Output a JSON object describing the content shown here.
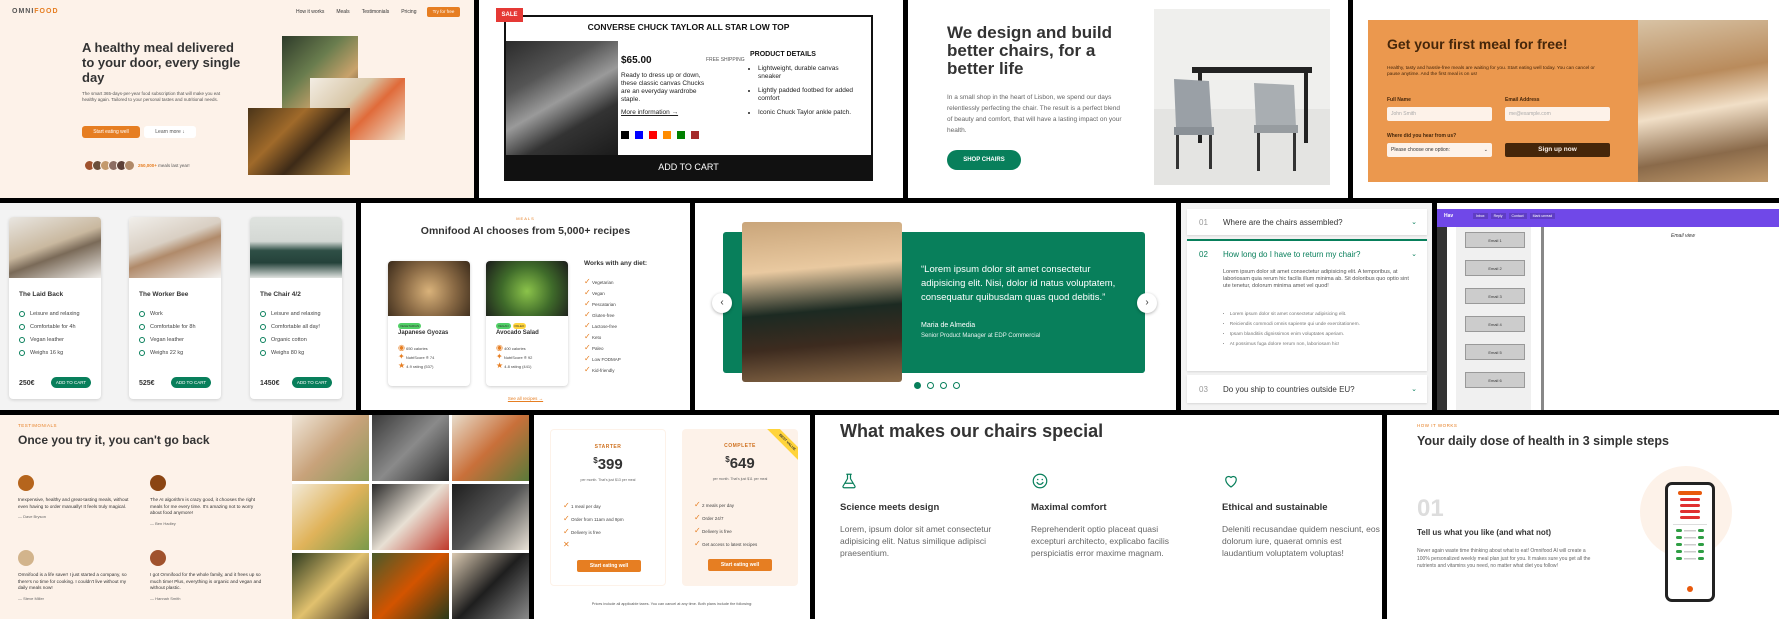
{
  "hero": {
    "logo_main": "OMNI",
    "logo_accent": "FOOD",
    "nav": [
      "How it works",
      "Meals",
      "Testimonials",
      "Pricing"
    ],
    "nav_cta": "Try for free",
    "title": "A healthy meal delivered to your door, every single day",
    "text": "The smart 365-days-per-year food subscription that will make you eat healthy again. Tailored to your personal tastes and nutritional needs.",
    "btn_primary": "Start eating well",
    "btn_secondary": "Learn more ↓",
    "delivered_count": "250,000+",
    "delivered_text": "meals last year!",
    "avatar_colors": [
      "#a0522d",
      "#6b4f3a",
      "#c49a6c",
      "#8d6e63",
      "#5d4037",
      "#b08968"
    ]
  },
  "product": {
    "sale_badge": "SALE",
    "title": "CONVERSE CHUCK TAYLOR ALL STAR LOW TOP",
    "price": "$65.00",
    "shipping": "FREE SHIPPING",
    "description": "Ready to dress up or down, these classic canvas Chucks are an everyday wardrobe staple.",
    "more_link": "More information →",
    "swatches": [
      "#000000",
      "#0000ff",
      "#ff0000",
      "#ff8c00",
      "#008000",
      "#a52a2a"
    ],
    "details_title": "PRODUCT DETAILS",
    "details": [
      "Lightweight, durable canvas sneaker",
      "Lightly padded footbed for added comfort",
      "Iconic Chuck Taylor ankle patch."
    ],
    "add_to_cart": "ADD TO CART"
  },
  "chairs_hero": {
    "title": "We design and build better chairs, for a better life",
    "text": "In a small shop in the heart of Lisbon, we spend our days relentlessly perfecting the chair. The result is a perfect blend of beauty and comfort, that will have a lasting impact on your health.",
    "button": "SHOP CHAIRS"
  },
  "signup": {
    "title": "Get your first meal for free!",
    "text": "Healthy, tasty and hassle-free meals are waiting for you. Start eating well today. You can cancel or pause anytime. And the first meal is on us!",
    "full_name_label": "Full Name",
    "full_name_placeholder": "John Smith",
    "email_label": "Email Address",
    "email_placeholder": "me@example.com",
    "source_label": "Where did you hear from us?",
    "source_value": "Please choose one option:",
    "submit": "Sign up now"
  },
  "chair_cards": [
    {
      "name": "The Laid Back",
      "features": [
        "Leisure and relaxing",
        "Comfortable for 4h",
        "Vegan leather",
        "Weighs 16 kg"
      ],
      "price": "250€",
      "button": "ADD TO CART"
    },
    {
      "name": "The Worker Bee",
      "features": [
        "Work",
        "Comfortable for 8h",
        "Vegan leather",
        "Weighs 22 kg"
      ],
      "price": "525€",
      "button": "ADD TO CART"
    },
    {
      "name": "The Chair 4/2",
      "features": [
        "Leisure and relaxing",
        "Comfortable all day!",
        "Organic cotton",
        "Weighs 80 kg"
      ],
      "price": "1450€",
      "button": "ADD TO CART"
    }
  ],
  "meals": {
    "tag": "MEALS",
    "title": "Omnifood AI chooses from 5,000+ recipes",
    "cards": [
      {
        "name": "Japanese Gyozas",
        "badges": [
          "VEGETARIAN"
        ],
        "stats": [
          "650 calories",
          "NutriScore ® 74",
          "4.9 rating (537)"
        ]
      },
      {
        "name": "Avocado Salad",
        "badges": [
          "VEGAN",
          "PALEO"
        ],
        "stats": [
          "400 calories",
          "NutriScore ® 92",
          "4.8 rating (441)"
        ]
      }
    ],
    "diet_title": "Works with any diet:",
    "diets": [
      "Vegetarian",
      "Vegan",
      "Pescatarian",
      "Gluten-free",
      "Lactose-free",
      "Keto",
      "Paleo",
      "Low FODMAP",
      "Kid-friendly"
    ],
    "all_link": "See all recipes →"
  },
  "slider": {
    "quote": "“Lorem ipsum dolor sit amet consectetur adipisicing elit. Nisi, dolor id natus voluptatem, consequatur quibusdam quas quod debitis.”",
    "author": "Maria de Almedia",
    "role": "Senior Product Manager at EDP Commercial",
    "prev": "‹",
    "next": "›"
  },
  "faq": [
    {
      "num": "01",
      "q": "Where are the chairs assembled?"
    },
    {
      "num": "02",
      "q": "How long do I have to return my chair?",
      "answer": "Lorem ipsum dolor sit amet consectetur adipisicing elit. A temporibus, at laboriosam quia rerum hic facilis illum minima ab. Sit doloribus quo optio sint ute tenetur, dolorum minima amet vel quod!",
      "bullets": [
        "Lorem ipsum dolor sit amet consectetur adipisicing elit.",
        "Reiciendis commodi omnis sapiente qui unde exercitationem.",
        "Ipsam blanditiis dignissimos enim voluptates aperiam.",
        "At possimus fuga dolore rerum non, laboriosam hic!"
      ]
    },
    {
      "num": "03",
      "q": "Do you ship to countries outside EU?"
    }
  ],
  "email_app": {
    "logo": "Hav",
    "tabs": [
      "Inbox",
      "Reply",
      "Contact",
      "Mark unread"
    ],
    "view_title": "Email view",
    "emails": [
      "Email 1",
      "Email 2",
      "Email 3",
      "Email 4",
      "Email 5",
      "Email 6"
    ]
  },
  "testimonials": {
    "tag": "TESTIMONIALS",
    "title": "Once you try it, you can't go back",
    "items": [
      {
        "text": "Inexpensive, healthy and great-tasting meals, without even having to order manually! It feels truly magical.",
        "name": "— Dave Bryson"
      },
      {
        "text": "The AI algorithm is crazy good, it chooses the right meals for me every time. It's amazing not to worry about food anymore!",
        "name": "— Ben Hadley"
      },
      {
        "text": "Omnifood is a life saver! I just started a company, so there's no time for cooking. I couldn't live without my daily meals now!",
        "name": "— Steve Miller"
      },
      {
        "text": "I got Omnifood for the whole family, and it frees up so much time! Plus, everything is organic and vegan and without plastic.",
        "name": "— Hannah Smith"
      }
    ]
  },
  "pricing": {
    "plans": [
      {
        "tier": "STARTER",
        "currency": "$",
        "price": "399",
        "note": "per month. That's just $13 per meal",
        "features": [
          "1 meal per day",
          "Order from 11am and 9pm",
          "Delivery is free",
          "✕"
        ],
        "button": "Start eating well"
      },
      {
        "tier": "COMPLETE",
        "currency": "$",
        "price": "649",
        "note": "per month. That's just $11 per meal",
        "features": [
          "2 meals per day",
          "Order 24/7",
          "Delivery is free",
          "Get access to latest recipes"
        ],
        "button": "Start eating well",
        "ribbon": "BEST VALUE"
      }
    ],
    "note": "Prices include all applicable taxes. You can cancel at any time. Both plans include the following:"
  },
  "special": {
    "title": "What makes our chairs special",
    "features": [
      {
        "icon": "flask-icon",
        "title": "Science meets design",
        "text": "Lorem, ipsum dolor sit amet consectetur adipisicing elit. Natus similique adipisci praesentium."
      },
      {
        "icon": "smile-icon",
        "title": "Maximal comfort",
        "text": "Reprehenderit optio placeat quasi excepturi architecto, explicabo facilis perspiciatis error maxime magnam."
      },
      {
        "icon": "heart-icon",
        "title": "Ethical and sustainable",
        "text": "Deleniti recusandae quidem nesciunt, eos dolorum iure, quaerat omnis est laudantium voluptatem voluptas!"
      }
    ]
  },
  "how": {
    "tag": "HOW IT WORKS",
    "title": "Your daily dose of health in 3 simple steps",
    "step_num": "01",
    "step_title": "Tell us what you like (and what not)",
    "step_text": "Never again waste time thinking about what to eat! Omnifood AI will create a 100% personalized weekly meal plan just for you. It makes sure you get all the nutrients and vitamins you need, no matter what diet you follow!"
  },
  "colors": {
    "orange": "#e67e22",
    "green": "#087f5b",
    "cream": "#fdf2e9",
    "purple": "#7048e8"
  }
}
